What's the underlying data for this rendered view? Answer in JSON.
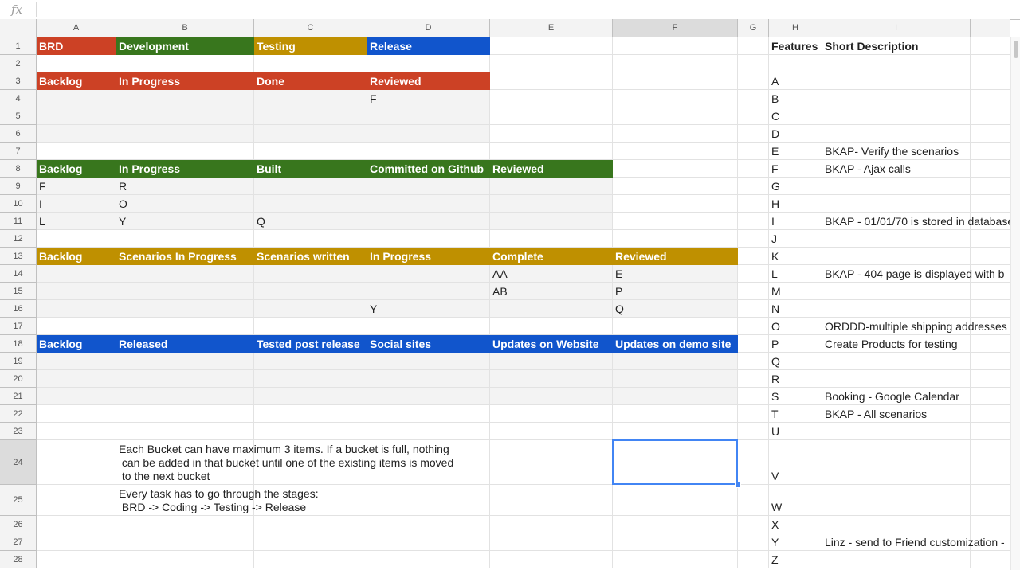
{
  "formula_bar": {
    "icon": "fx-icon",
    "value": ""
  },
  "colors": {
    "red": "#cc4125",
    "green": "#38761d",
    "gold": "#bf9000",
    "blue": "#1155cc",
    "selection": "#4285f4"
  },
  "columns": [
    "A",
    "B",
    "C",
    "D",
    "E",
    "F",
    "G",
    "H",
    "I"
  ],
  "rows": [
    "1",
    "2",
    "3",
    "4",
    "5",
    "6",
    "7",
    "8",
    "9",
    "10",
    "11",
    "12",
    "13",
    "14",
    "15",
    "16",
    "17",
    "18",
    "19",
    "20",
    "21",
    "22",
    "23",
    "24",
    "25",
    "26",
    "27",
    "28"
  ],
  "selected": {
    "column": "F",
    "row": "24"
  },
  "cells": {
    "A1": {
      "text": "BRD",
      "fill": "red"
    },
    "B1": {
      "text": "Development",
      "fill": "green"
    },
    "C1": {
      "text": "Testing",
      "fill": "gold"
    },
    "D1": {
      "text": "Release",
      "fill": "blue"
    },
    "H1": {
      "text": "Features",
      "bold": true
    },
    "I1": {
      "text": "Short Description",
      "bold": true
    },
    "A3": {
      "text": "Backlog",
      "fill": "red"
    },
    "B3": {
      "text": "In Progress",
      "fill": "red"
    },
    "C3": {
      "text": "Done",
      "fill": "red"
    },
    "D3": {
      "text": "Reviewed",
      "fill": "red"
    },
    "D4": {
      "text": "F"
    },
    "A8": {
      "text": "Backlog",
      "fill": "green"
    },
    "B8": {
      "text": "In Progress",
      "fill": "green"
    },
    "C8": {
      "text": "Built",
      "fill": "green"
    },
    "D8": {
      "text": "Committed on Github",
      "fill": "green"
    },
    "E8": {
      "text": "Reviewed",
      "fill": "green"
    },
    "A9": {
      "text": "F"
    },
    "B9": {
      "text": "R"
    },
    "A10": {
      "text": "I"
    },
    "B10": {
      "text": "O"
    },
    "A11": {
      "text": "L"
    },
    "B11": {
      "text": "Y"
    },
    "C11": {
      "text": "Q"
    },
    "A13": {
      "text": "Backlog",
      "fill": "gold"
    },
    "B13": {
      "text": "Scenarios In Progress",
      "fill": "gold"
    },
    "C13": {
      "text": "Scenarios written",
      "fill": "gold"
    },
    "D13": {
      "text": "In Progress",
      "fill": "gold"
    },
    "E13": {
      "text": "Complete",
      "fill": "gold"
    },
    "F13": {
      "text": "Reviewed",
      "fill": "gold"
    },
    "E14": {
      "text": "AA"
    },
    "F14": {
      "text": "E"
    },
    "E15": {
      "text": "AB"
    },
    "F15": {
      "text": "P"
    },
    "D16": {
      "text": "Y"
    },
    "F16": {
      "text": "Q"
    },
    "A18": {
      "text": "Backlog",
      "fill": "blue"
    },
    "B18": {
      "text": "Released",
      "fill": "blue"
    },
    "C18": {
      "text": "Tested post release",
      "fill": "blue"
    },
    "D18": {
      "text": "Social sites",
      "fill": "blue"
    },
    "E18": {
      "text": "Updates on Website",
      "fill": "blue"
    },
    "F18": {
      "text": "Updates on demo site",
      "fill": "blue"
    },
    "B24": {
      "text": "Each Bucket can have maximum 3 items. If a bucket is full, nothing\n can be added in that bucket until one of the existing items is moved\n to the next bucket",
      "wrap": true
    },
    "B25": {
      "text": "Every task has to go through the stages:\n BRD -> Coding -> Testing -> Release",
      "wrap": true
    },
    "H3": {
      "text": "A"
    },
    "H4": {
      "text": "B"
    },
    "H5": {
      "text": "C"
    },
    "H6": {
      "text": "D"
    },
    "H7": {
      "text": "E"
    },
    "I7": {
      "text": "BKAP- Verify the scenarios"
    },
    "H8": {
      "text": "F"
    },
    "I8": {
      "text": "BKAP - Ajax calls"
    },
    "H9": {
      "text": "G"
    },
    "H10": {
      "text": "H"
    },
    "H11": {
      "text": "I"
    },
    "I11": {
      "text": "BKAP - 01/01/70 is stored in database"
    },
    "H12": {
      "text": "J"
    },
    "H13": {
      "text": "K"
    },
    "H14": {
      "text": "L"
    },
    "I14": {
      "text": "BKAP -  404 page is displayed with b"
    },
    "H15": {
      "text": "M"
    },
    "H16": {
      "text": "N"
    },
    "H17": {
      "text": "O"
    },
    "I17": {
      "text": "ORDDD-multiple shipping addresses"
    },
    "H18": {
      "text": "P"
    },
    "I18": {
      "text": "Create Products for testing"
    },
    "H19": {
      "text": "Q"
    },
    "H20": {
      "text": "R"
    },
    "H21": {
      "text": "S"
    },
    "I21": {
      "text": "Booking - Google Calendar"
    },
    "H22": {
      "text": "T"
    },
    "I22": {
      "text": "BKAP - All scenarios"
    },
    "H23": {
      "text": "U"
    },
    "H24": {
      "text": "V"
    },
    "H25": {
      "text": "W"
    },
    "H26": {
      "text": "X"
    },
    "H27": {
      "text": "Y"
    },
    "I27": {
      "text": "Linz - send to Friend customization - "
    },
    "H28": {
      "text": "Z"
    }
  },
  "grey_ranges": [
    "A4:D6",
    "A9:E11",
    "A14:F16",
    "A19:F21"
  ]
}
